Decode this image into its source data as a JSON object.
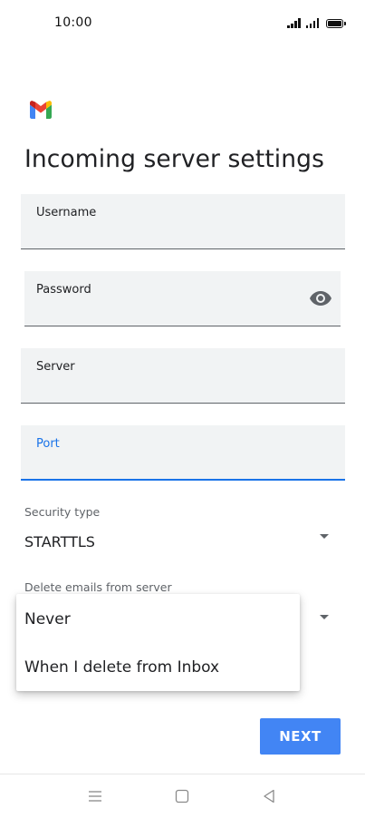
{
  "status_bar": {
    "time": "10:00"
  },
  "header": {
    "logo": "gmail-logo",
    "title": "Incoming server settings"
  },
  "form": {
    "username": {
      "label": "Username",
      "value": ""
    },
    "password": {
      "label": "Password",
      "value": "",
      "toggle_icon": "eye-icon"
    },
    "server": {
      "label": "Server",
      "value": ""
    },
    "port": {
      "label": "Port",
      "value": "",
      "focused": true
    },
    "security_type": {
      "label": "Security type",
      "value": "STARTTLS"
    },
    "delete_emails": {
      "label": "Delete emails from server",
      "options": [
        "Never",
        "When I delete from Inbox"
      ]
    }
  },
  "actions": {
    "next_label": "NEXT"
  },
  "colors": {
    "accent": "#1a73e8",
    "button": "#4285f4",
    "field_bg": "#f1f3f4"
  },
  "nav_bar": {
    "icons": [
      "menu-icon",
      "home-icon",
      "back-icon"
    ]
  }
}
